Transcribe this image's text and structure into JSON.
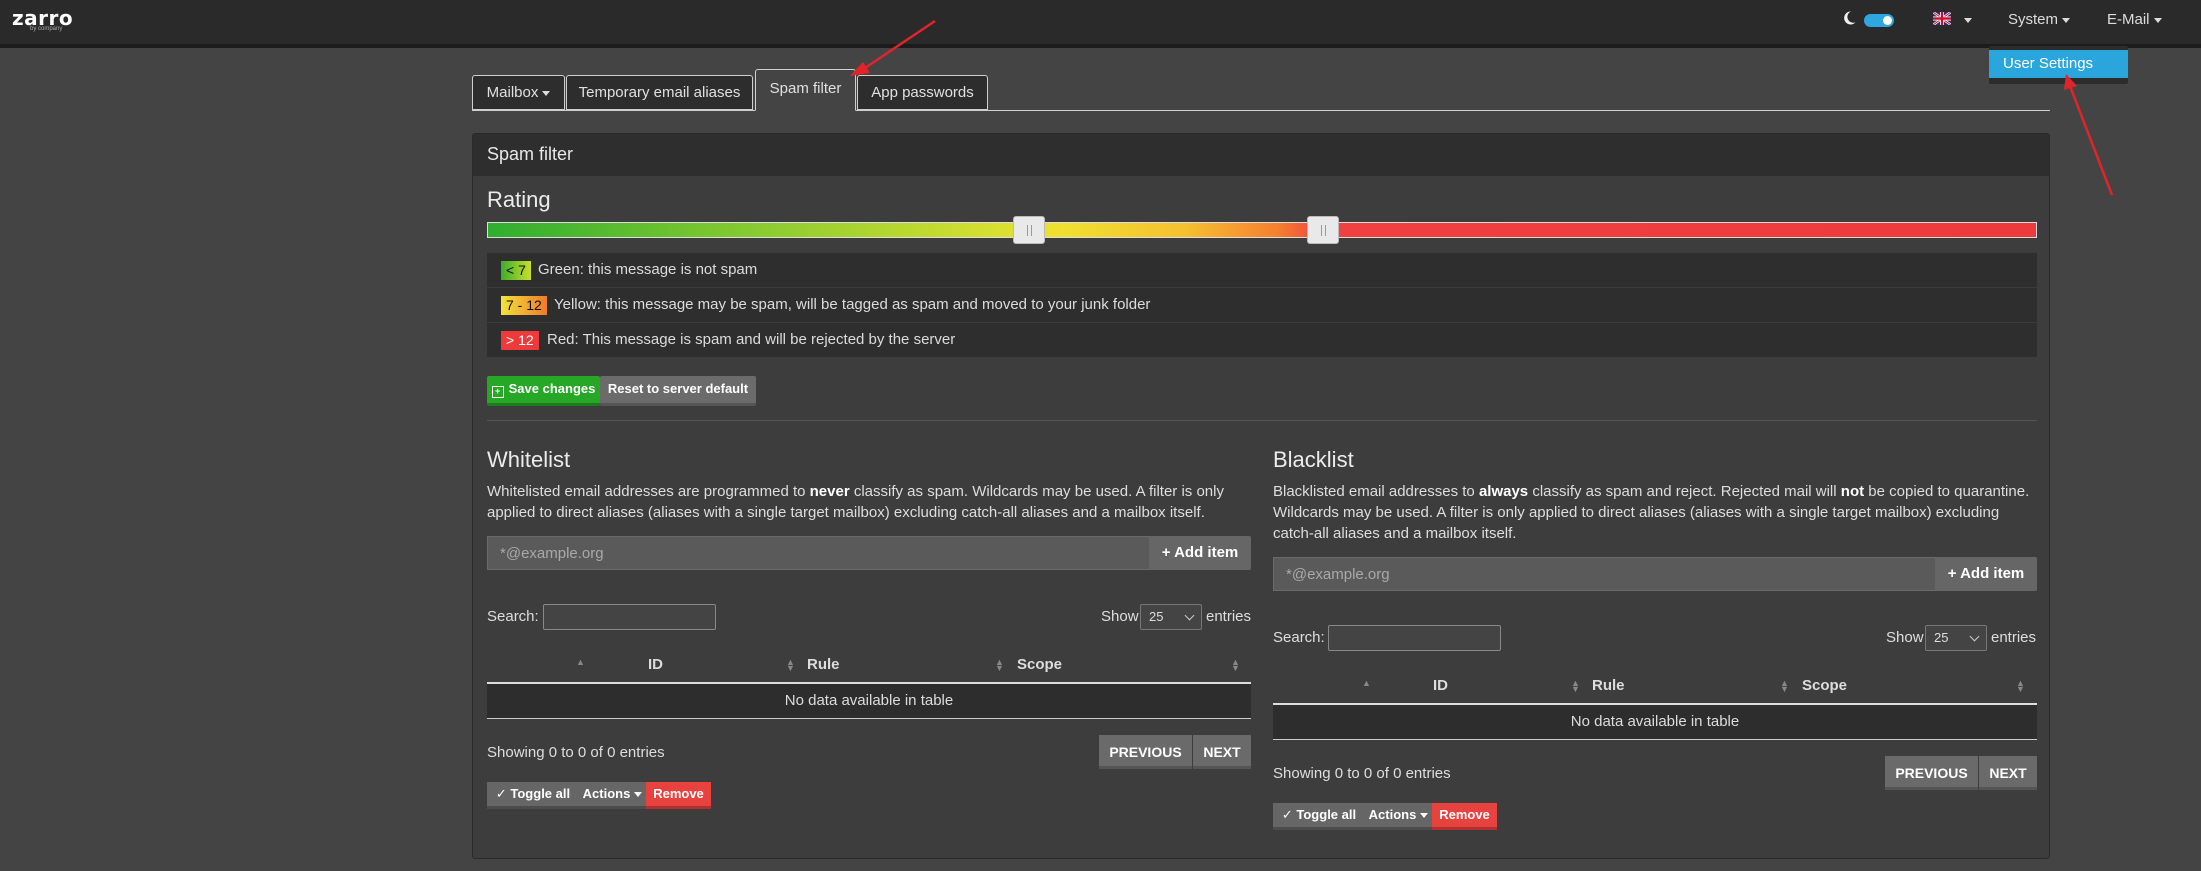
{
  "navbar": {
    "logo": "zarro",
    "logo_sub": "by company",
    "system_label": "System",
    "email_label": "E-Mail",
    "dropdown_item": "User Settings"
  },
  "tabs": [
    {
      "label": "Mailbox"
    },
    {
      "label": "Temporary email aliases"
    },
    {
      "label": "Spam filter"
    },
    {
      "label": "App passwords"
    }
  ],
  "panel": {
    "title": "Spam filter",
    "rating_heading": "Rating",
    "slider": {
      "low_handle": 7,
      "high_handle": 12
    },
    "legend": [
      {
        "badge": "< 7",
        "text": "Green: this message is not spam"
      },
      {
        "badge": "7 - 12",
        "text": "Yellow: this message may be spam, will be tagged as spam and moved to your junk folder"
      },
      {
        "badge": "> 12",
        "text": "Red: This message is spam and will be rejected by the server"
      }
    ],
    "save_label": "Save changes",
    "reset_label": "Reset to server default"
  },
  "whitelist": {
    "title": "Whitelist",
    "desc_1": "Whitelisted email addresses are programmed to ",
    "desc_bold": "never",
    "desc_2": " classify as spam. Wildcards may be used. A filter is only applied to direct aliases (aliases with a single target mailbox) excluding catch-all aliases and a mailbox itself.",
    "input_placeholder": "*@example.org",
    "add_label": "+ Add item",
    "search_label": "Search:",
    "show_label": "Show",
    "show_value": "25",
    "entries_label": "entries",
    "columns": [
      "ID",
      "Rule",
      "Scope"
    ],
    "empty": "No data available in table",
    "info": "Showing 0 to 0 of 0 entries",
    "prev": "PREVIOUS",
    "next": "NEXT",
    "toggle_all": "Toggle all",
    "actions": "Actions",
    "remove": "Remove"
  },
  "blacklist": {
    "title": "Blacklist",
    "desc_1": "Blacklisted email addresses to ",
    "desc_bold": "always",
    "desc_2": " classify as spam and reject. Rejected mail will ",
    "desc_bold2": "not",
    "desc_3": " be copied to quarantine. Wildcards may be used. A filter is only applied to direct aliases (aliases with a single target mailbox) excluding catch-all aliases and a mailbox itself.",
    "input_placeholder": "*@example.org",
    "add_label": "+ Add item",
    "search_label": "Search:",
    "show_label": "Show",
    "show_value": "25",
    "entries_label": "entries",
    "columns": [
      "ID",
      "Rule",
      "Scope"
    ],
    "empty": "No data available in table",
    "info": "Showing 0 to 0 of 0 entries",
    "prev": "PREVIOUS",
    "next": "NEXT",
    "toggle_all": "Toggle all",
    "actions": "Actions",
    "remove": "Remove"
  },
  "colors": {
    "accent": "#2aa6dc",
    "success": "#26a826",
    "danger": "#e8423f",
    "annotation_arrow": "#e0242a"
  }
}
